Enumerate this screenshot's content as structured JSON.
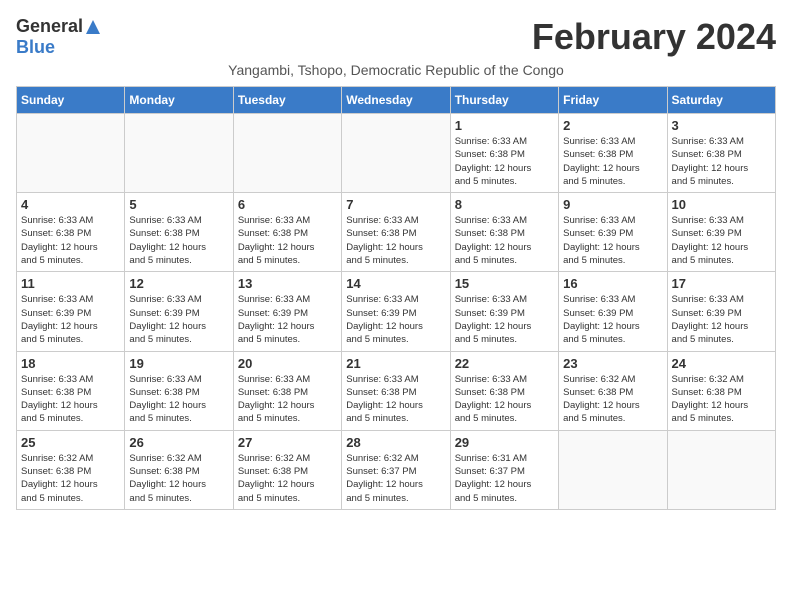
{
  "logo": {
    "general": "General",
    "blue": "Blue"
  },
  "title": "February 2024",
  "subtitle": "Yangambi, Tshopo, Democratic Republic of the Congo",
  "headers": [
    "Sunday",
    "Monday",
    "Tuesday",
    "Wednesday",
    "Thursday",
    "Friday",
    "Saturday"
  ],
  "weeks": [
    [
      {
        "day": "",
        "detail": ""
      },
      {
        "day": "",
        "detail": ""
      },
      {
        "day": "",
        "detail": ""
      },
      {
        "day": "",
        "detail": ""
      },
      {
        "day": "1",
        "detail": "Sunrise: 6:33 AM\nSunset: 6:38 PM\nDaylight: 12 hours\nand 5 minutes."
      },
      {
        "day": "2",
        "detail": "Sunrise: 6:33 AM\nSunset: 6:38 PM\nDaylight: 12 hours\nand 5 minutes."
      },
      {
        "day": "3",
        "detail": "Sunrise: 6:33 AM\nSunset: 6:38 PM\nDaylight: 12 hours\nand 5 minutes."
      }
    ],
    [
      {
        "day": "4",
        "detail": "Sunrise: 6:33 AM\nSunset: 6:38 PM\nDaylight: 12 hours\nand 5 minutes."
      },
      {
        "day": "5",
        "detail": "Sunrise: 6:33 AM\nSunset: 6:38 PM\nDaylight: 12 hours\nand 5 minutes."
      },
      {
        "day": "6",
        "detail": "Sunrise: 6:33 AM\nSunset: 6:38 PM\nDaylight: 12 hours\nand 5 minutes."
      },
      {
        "day": "7",
        "detail": "Sunrise: 6:33 AM\nSunset: 6:38 PM\nDaylight: 12 hours\nand 5 minutes."
      },
      {
        "day": "8",
        "detail": "Sunrise: 6:33 AM\nSunset: 6:38 PM\nDaylight: 12 hours\nand 5 minutes."
      },
      {
        "day": "9",
        "detail": "Sunrise: 6:33 AM\nSunset: 6:39 PM\nDaylight: 12 hours\nand 5 minutes."
      },
      {
        "day": "10",
        "detail": "Sunrise: 6:33 AM\nSunset: 6:39 PM\nDaylight: 12 hours\nand 5 minutes."
      }
    ],
    [
      {
        "day": "11",
        "detail": "Sunrise: 6:33 AM\nSunset: 6:39 PM\nDaylight: 12 hours\nand 5 minutes."
      },
      {
        "day": "12",
        "detail": "Sunrise: 6:33 AM\nSunset: 6:39 PM\nDaylight: 12 hours\nand 5 minutes."
      },
      {
        "day": "13",
        "detail": "Sunrise: 6:33 AM\nSunset: 6:39 PM\nDaylight: 12 hours\nand 5 minutes."
      },
      {
        "day": "14",
        "detail": "Sunrise: 6:33 AM\nSunset: 6:39 PM\nDaylight: 12 hours\nand 5 minutes."
      },
      {
        "day": "15",
        "detail": "Sunrise: 6:33 AM\nSunset: 6:39 PM\nDaylight: 12 hours\nand 5 minutes."
      },
      {
        "day": "16",
        "detail": "Sunrise: 6:33 AM\nSunset: 6:39 PM\nDaylight: 12 hours\nand 5 minutes."
      },
      {
        "day": "17",
        "detail": "Sunrise: 6:33 AM\nSunset: 6:39 PM\nDaylight: 12 hours\nand 5 minutes."
      }
    ],
    [
      {
        "day": "18",
        "detail": "Sunrise: 6:33 AM\nSunset: 6:38 PM\nDaylight: 12 hours\nand 5 minutes."
      },
      {
        "day": "19",
        "detail": "Sunrise: 6:33 AM\nSunset: 6:38 PM\nDaylight: 12 hours\nand 5 minutes."
      },
      {
        "day": "20",
        "detail": "Sunrise: 6:33 AM\nSunset: 6:38 PM\nDaylight: 12 hours\nand 5 minutes."
      },
      {
        "day": "21",
        "detail": "Sunrise: 6:33 AM\nSunset: 6:38 PM\nDaylight: 12 hours\nand 5 minutes."
      },
      {
        "day": "22",
        "detail": "Sunrise: 6:33 AM\nSunset: 6:38 PM\nDaylight: 12 hours\nand 5 minutes."
      },
      {
        "day": "23",
        "detail": "Sunrise: 6:32 AM\nSunset: 6:38 PM\nDaylight: 12 hours\nand 5 minutes."
      },
      {
        "day": "24",
        "detail": "Sunrise: 6:32 AM\nSunset: 6:38 PM\nDaylight: 12 hours\nand 5 minutes."
      }
    ],
    [
      {
        "day": "25",
        "detail": "Sunrise: 6:32 AM\nSunset: 6:38 PM\nDaylight: 12 hours\nand 5 minutes."
      },
      {
        "day": "26",
        "detail": "Sunrise: 6:32 AM\nSunset: 6:38 PM\nDaylight: 12 hours\nand 5 minutes."
      },
      {
        "day": "27",
        "detail": "Sunrise: 6:32 AM\nSunset: 6:38 PM\nDaylight: 12 hours\nand 5 minutes."
      },
      {
        "day": "28",
        "detail": "Sunrise: 6:32 AM\nSunset: 6:37 PM\nDaylight: 12 hours\nand 5 minutes."
      },
      {
        "day": "29",
        "detail": "Sunrise: 6:31 AM\nSunset: 6:37 PM\nDaylight: 12 hours\nand 5 minutes."
      },
      {
        "day": "",
        "detail": ""
      },
      {
        "day": "",
        "detail": ""
      }
    ]
  ]
}
